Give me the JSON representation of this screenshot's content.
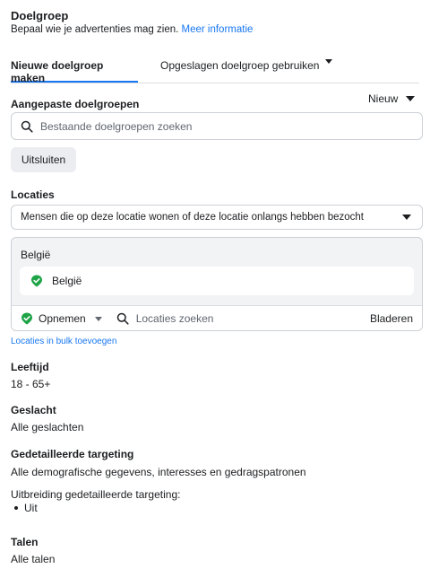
{
  "header": {
    "title": "Doelgroep",
    "subtitle": "Bepaal wie je advertenties mag zien.",
    "more_info": "Meer informatie"
  },
  "tabs": {
    "new": "Nieuwe doelgroep maken",
    "saved": "Opgeslagen doelgroep gebruiken"
  },
  "custom_audiences": {
    "label": "Aangepaste doelgroepen",
    "new_dropdown": "Nieuw",
    "search_placeholder": "Bestaande doelgroepen zoeken",
    "exclude_button": "Uitsluiten"
  },
  "locations": {
    "label": "Locaties",
    "type_select": "Mensen die op deze locatie wonen of deze locatie onlangs hebben bezocht",
    "country_header": "België",
    "selected_item": "België",
    "include_select": "Opnemen",
    "search_placeholder": "Locaties zoeken",
    "browse": "Bladeren",
    "bulk_link": "Locaties in bulk toevoegen"
  },
  "age": {
    "label": "Leeftijd",
    "value": "18 - 65+"
  },
  "gender": {
    "label": "Geslacht",
    "value": "Alle geslachten"
  },
  "targeting": {
    "label": "Gedetailleerde targeting",
    "value": "Alle demografische gegevens, interesses en gedragspatronen",
    "expansion_label": "Uitbreiding gedetailleerde targeting:",
    "expansion_value": "Uit"
  },
  "languages": {
    "label": "Talen",
    "value": "Alle talen"
  },
  "colors": {
    "accent": "#1877f2",
    "success": "#1ea446"
  }
}
